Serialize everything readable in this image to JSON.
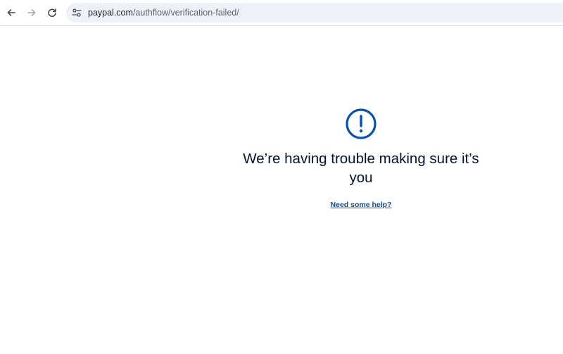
{
  "browser": {
    "url_domain": "paypal.com",
    "url_path": "/authflow/verification-failed/",
    "icons": {
      "back": "arrow-left-icon",
      "forward": "arrow-right-icon",
      "reload": "reload-icon",
      "site_info": "tune-icon"
    }
  },
  "page": {
    "icon": "exclamation-circle-icon",
    "headline": "We’re having trouble making sure it’s you",
    "help_link": "Need some help?"
  },
  "colors": {
    "accent": "#0551b5",
    "headline_text": "#001435",
    "address_bar_bg": "#eef2f8"
  }
}
